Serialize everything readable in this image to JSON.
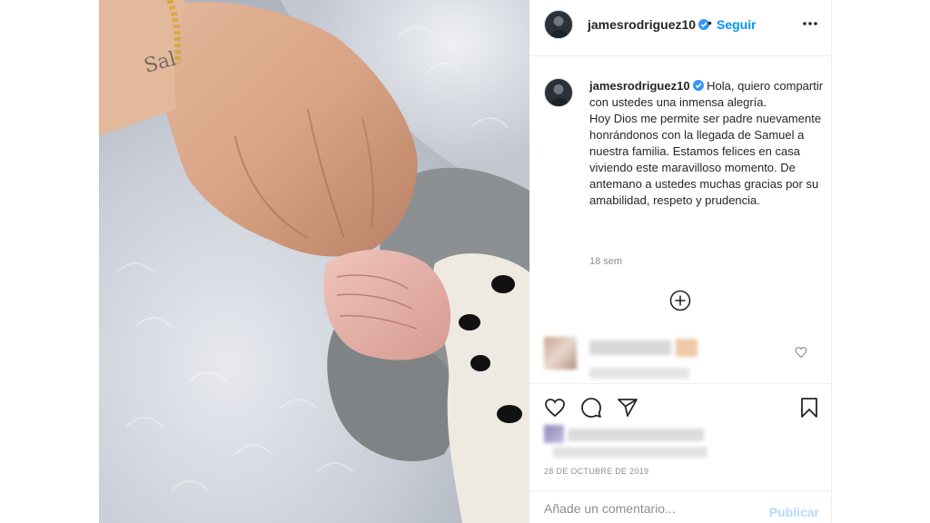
{
  "post": {
    "username": "jamesrodriguez10",
    "follow_label": "Seguir",
    "separator": "•",
    "caption": "Hola, quiero compartir con ustedes una inmensa alegría.\nHoy Dios me permite ser padre nuevamente honrándonos con la llegada de Samuel a nuestra familia. Estamos felices en casa viviendo este maravilloso momento. De antemano a ustedes muchas gracias por su amabilidad, respeto y prudencia.",
    "time_ago": "18 sem",
    "date": "28 DE OCTUBRE DE 2019"
  },
  "comment_box": {
    "placeholder": "Añade un comentario...",
    "publish_label": "Publicar"
  },
  "colors": {
    "link_blue": "#0095f6",
    "publish_disabled": "#b3dbff",
    "verified_blue": "#3897f0",
    "muted_gray": "#8e8e8e"
  },
  "icons": {
    "more": "more-options-icon",
    "verified": "verified-badge-icon",
    "add": "plus-circle-icon",
    "like": "heart-icon",
    "comment": "comment-icon",
    "share": "share-icon",
    "save": "bookmark-icon"
  }
}
